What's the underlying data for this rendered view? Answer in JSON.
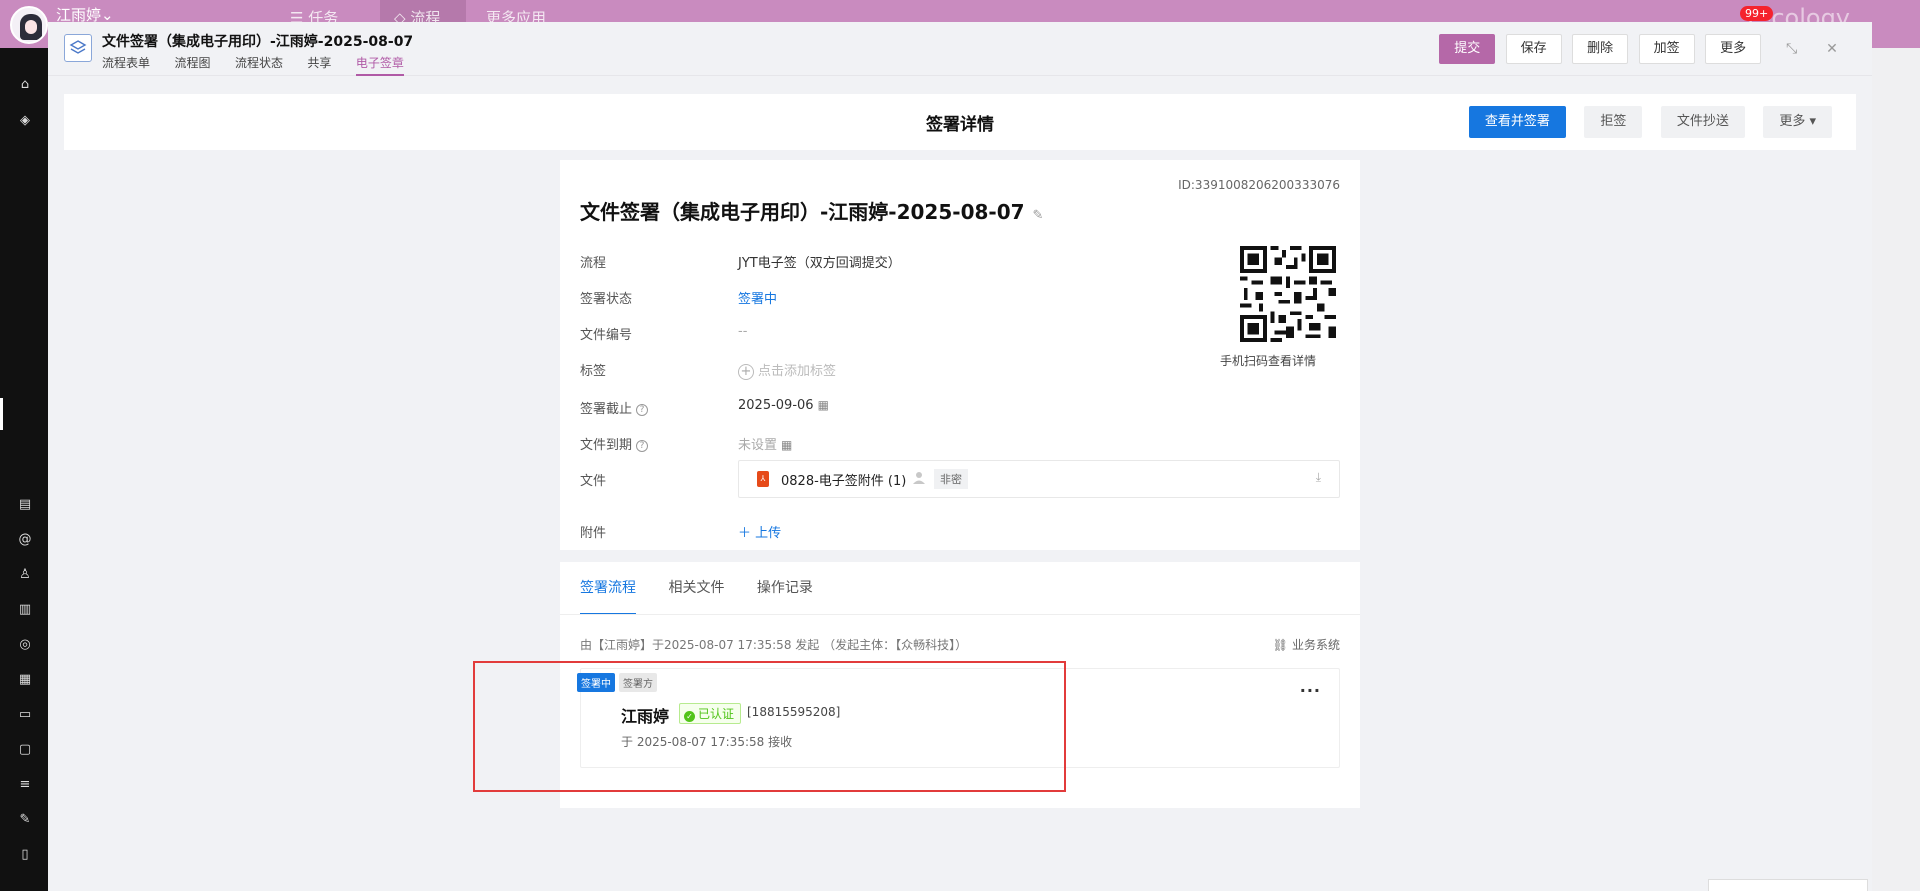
{
  "app": {
    "username": "江雨婷",
    "nav": [
      "任务",
      "流程",
      "更多应用"
    ],
    "badge": "99+",
    "brand": "e-cology"
  },
  "modal": {
    "title": "文件签署（集成电子用印）-江雨婷-2025-08-07",
    "tabs": [
      "流程表单",
      "流程图",
      "流程状态",
      "共享",
      "电子签章"
    ],
    "active_tab": "电子签章",
    "buttons": {
      "submit": "提交",
      "save": "保存",
      "delete": "删除",
      "countersign": "加签",
      "more": "更多"
    }
  },
  "detail": {
    "heading": "签署详情",
    "buttons": {
      "view_sign": "查看并签署",
      "reject": "拒签",
      "copy": "文件抄送",
      "more": "更多 ▾"
    },
    "id": "ID:3391008206200333076",
    "doc_title": "文件签署（集成电子用印）-江雨婷-2025-08-07",
    "fields": {
      "flow_label": "流程",
      "flow_value": "JYT电子签（双方回调提交）",
      "status_label": "签署状态",
      "status_value": "签署中",
      "file_no_label": "文件编号",
      "file_no_value": "--",
      "tag_label": "标签",
      "tag_value": "点击添加标签",
      "deadline_label": "签署截止",
      "deadline_value": "2025-09-06",
      "expiry_label": "文件到期",
      "expiry_value": "未设置",
      "file_label": "文件",
      "attach_label": "附件",
      "upload": "上传"
    },
    "file": {
      "name": "0828-电子签附件 (1)",
      "security": "非密"
    },
    "qr_caption": "手机扫码查看详情"
  },
  "flow": {
    "tabs": [
      "签署流程",
      "相关文件",
      "操作记录"
    ],
    "active_tab": "签署流程",
    "initiator_info": "由【江雨婷】于2025-08-07 17:35:58 发起 （发起主体：【众畅科技】）",
    "biz_system": "业务系统",
    "signer": {
      "status_badge": "签署中",
      "role_badge": "签署方",
      "name": "江雨婷",
      "verified": "已认证",
      "phone": "[18815595208]",
      "received": "于 2025-08-07 17:35:58 接收"
    }
  },
  "colors": {
    "brand_purple": "#b568a8",
    "primary_blue": "#1677e0",
    "highlight_red": "#e23b3b",
    "verified_green": "#52c41a"
  }
}
